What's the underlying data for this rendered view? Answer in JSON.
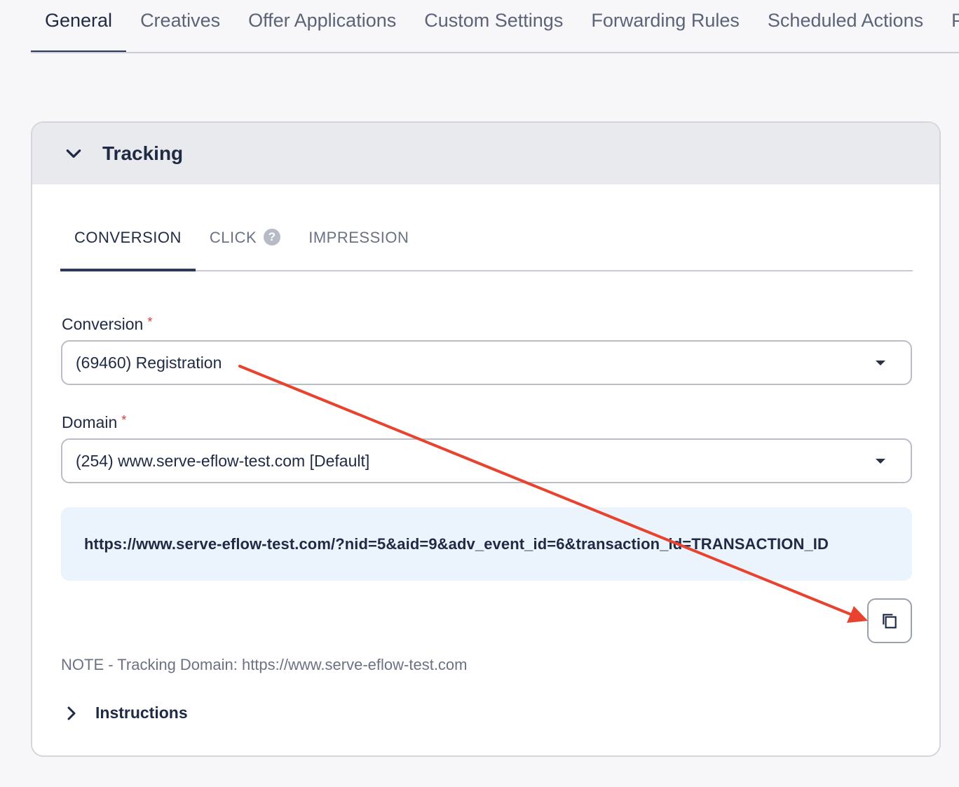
{
  "top_tabs": [
    {
      "label": "General",
      "active": true
    },
    {
      "label": "Creatives"
    },
    {
      "label": "Offer Applications"
    },
    {
      "label": "Custom Settings"
    },
    {
      "label": "Forwarding Rules"
    },
    {
      "label": "Scheduled Actions"
    },
    {
      "label": "Po"
    }
  ],
  "card": {
    "title": "Tracking",
    "sub_tabs": [
      {
        "label": "CONVERSION",
        "active": true
      },
      {
        "label": "CLICK",
        "help": "?"
      },
      {
        "label": "IMPRESSION"
      }
    ],
    "conversion": {
      "label": "Conversion",
      "required_mark": "*",
      "value": "(69460) Registration"
    },
    "domain": {
      "label": "Domain",
      "required_mark": "*",
      "value": "(254) www.serve-eflow-test.com [Default]"
    },
    "tracking_url": "https://www.serve-eflow-test.com/?nid=5&aid=9&adv_event_id=6&transaction_id=TRANSACTION_ID",
    "copy_button_icon": "copy-icon",
    "note": "NOTE - Tracking Domain: https://www.serve-eflow-test.com",
    "instructions_label": "Instructions"
  },
  "colors": {
    "annotation_arrow": "#e8432f",
    "active_tab_underline": "#2b3a5c",
    "url_box_bg": "#ebf3fd"
  }
}
